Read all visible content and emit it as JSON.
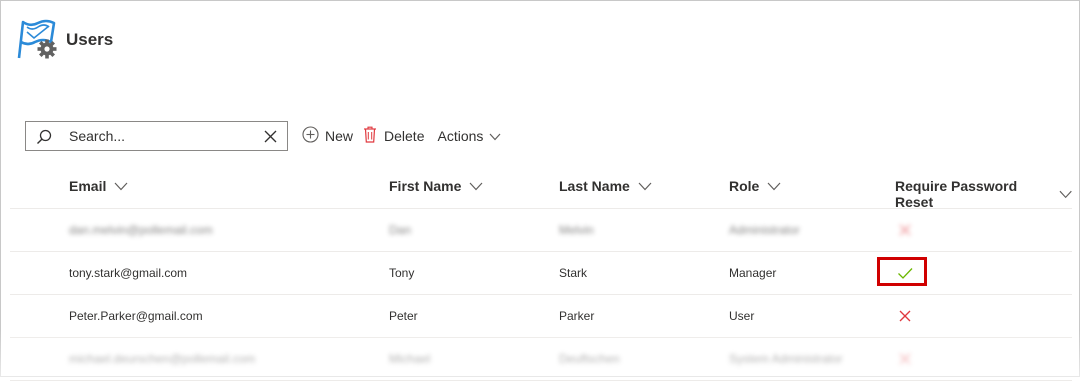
{
  "page": {
    "title": "Users"
  },
  "colors": {
    "accent": "#2b8ad8",
    "gear": "#616161",
    "check": "#6bb700",
    "cross": "#e0383e",
    "highlight": "#d00000"
  },
  "toolbar": {
    "search_placeholder": "Search...",
    "new_label": "New",
    "delete_label": "Delete",
    "actions_label": "Actions"
  },
  "table": {
    "columns": [
      "Email",
      "First Name",
      "Last Name",
      "Role",
      "Require Password Reset"
    ],
    "rows": [
      {
        "email": "dan.melvin@pollemail.com",
        "first": "Dan",
        "last": "Melvin",
        "role": "Administrator",
        "reset": "no",
        "blurred": true
      },
      {
        "email": "tony.stark@gmail.com",
        "first": "Tony",
        "last": "Stark",
        "role": "Manager",
        "reset": "yes",
        "blurred": false
      },
      {
        "email": "Peter.Parker@gmail.com",
        "first": "Peter",
        "last": "Parker",
        "role": "User",
        "reset": "no",
        "blurred": false
      },
      {
        "email": "michael.deurschen@pollemail.com",
        "first": "Michael",
        "last": "Deuftschen",
        "role": "System Administrator",
        "reset": "no",
        "blurred": true
      }
    ]
  },
  "icons": {
    "logo": "flag-gear-logo-icon",
    "search": "search-icon",
    "clear": "close-icon",
    "new": "add-circle-icon",
    "delete": "trash-icon",
    "chevron": "chevron-down-icon",
    "check": "checkmark-icon",
    "cross": "cross-icon"
  }
}
